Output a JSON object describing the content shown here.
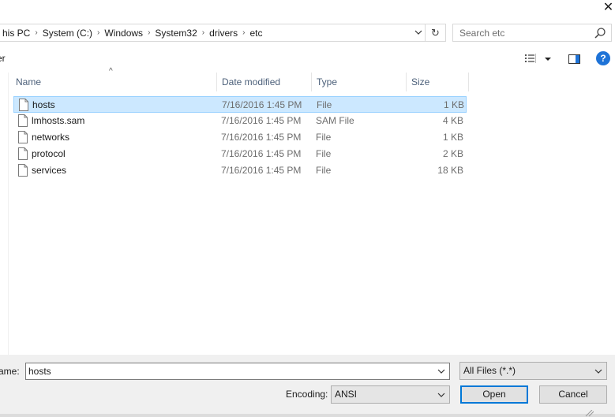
{
  "window": {
    "close_label": "✕"
  },
  "address_bar": {
    "crumbs": [
      "his PC",
      "System (C:)",
      "Windows",
      "System32",
      "drivers",
      "etc"
    ],
    "refresh_icon": "refresh-icon",
    "dropdown_icon": "chevron-down-icon"
  },
  "search": {
    "placeholder": "Search etc",
    "icon": "search-icon"
  },
  "toolbar": {
    "new_folder_label": "er",
    "help_label": "?"
  },
  "columns": {
    "name": "Name",
    "date_modified": "Date modified",
    "type": "Type",
    "size": "Size"
  },
  "files": [
    {
      "name": "hosts",
      "date": "7/16/2016 1:45 PM",
      "type": "File",
      "size": "1 KB",
      "selected": true
    },
    {
      "name": "lmhosts.sam",
      "date": "7/16/2016 1:45 PM",
      "type": "SAM File",
      "size": "4 KB",
      "selected": false
    },
    {
      "name": "networks",
      "date": "7/16/2016 1:45 PM",
      "type": "File",
      "size": "1 KB",
      "selected": false
    },
    {
      "name": "protocol",
      "date": "7/16/2016 1:45 PM",
      "type": "File",
      "size": "2 KB",
      "selected": false
    },
    {
      "name": "services",
      "date": "7/16/2016 1:45 PM",
      "type": "File",
      "size": "18 KB",
      "selected": false
    }
  ],
  "bottom": {
    "filename_label": "ame:",
    "filename_value": "hosts",
    "filetype_value": "All Files  (*.*)",
    "encoding_label": "Encoding:",
    "encoding_value": "ANSI",
    "open_label": "Open",
    "cancel_label": "Cancel"
  },
  "colors": {
    "selection_bg": "#cce8ff",
    "selection_border": "#99d1ff",
    "accent": "#0078d7",
    "header_text": "#4c607a"
  }
}
